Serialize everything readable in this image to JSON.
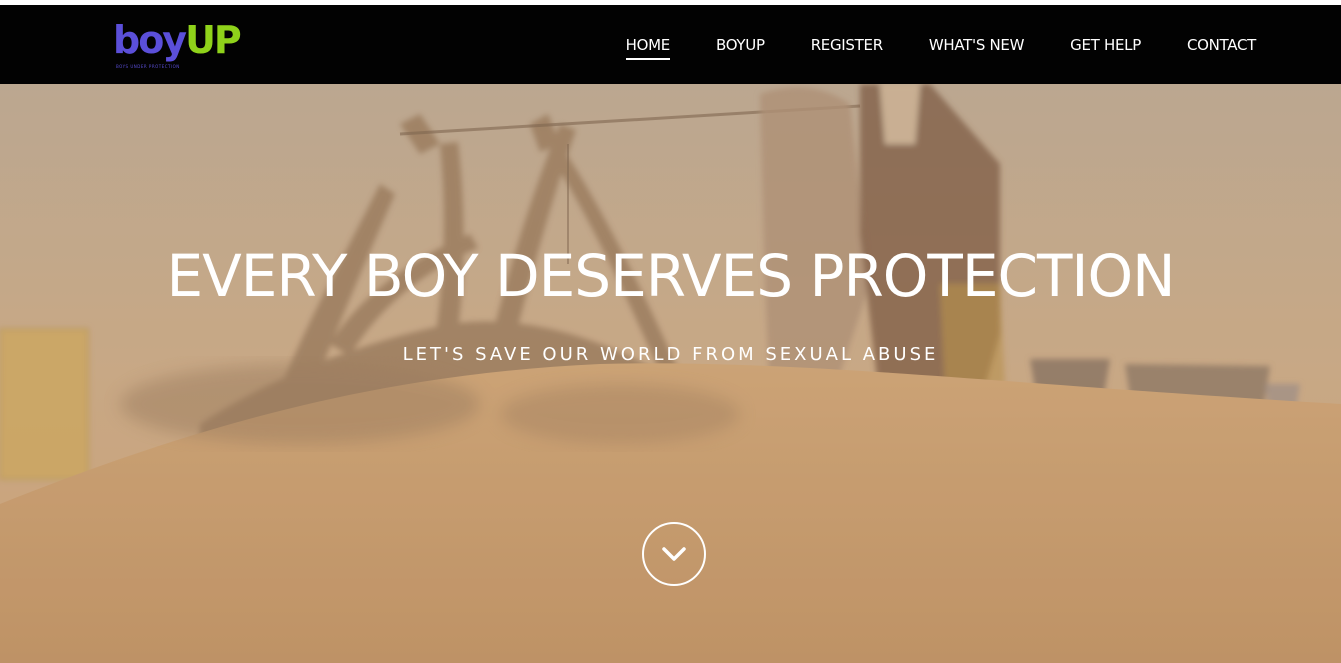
{
  "brand": {
    "logo_primary": "boy",
    "logo_secondary": "UP",
    "tagline": "BOYS UNDER PROTECTION",
    "colors": {
      "boy": "#5b4fd9",
      "up": "#8fd21a",
      "navbar": "#020202"
    }
  },
  "nav": {
    "items": [
      {
        "label": "HOME",
        "active": true
      },
      {
        "label": "BOYUP",
        "active": false
      },
      {
        "label": "REGISTER",
        "active": false
      },
      {
        "label": "WHAT'S NEW",
        "active": false
      },
      {
        "label": "GET HELP",
        "active": false
      },
      {
        "label": "CONTACT",
        "active": false
      }
    ]
  },
  "hero": {
    "title": "EVERY BOY DESERVES PROTECTION",
    "subtitle": "LET'S SAVE OUR WORLD FROM SEXUAL ABUSE",
    "scroll_icon": "chevron-down-icon"
  }
}
